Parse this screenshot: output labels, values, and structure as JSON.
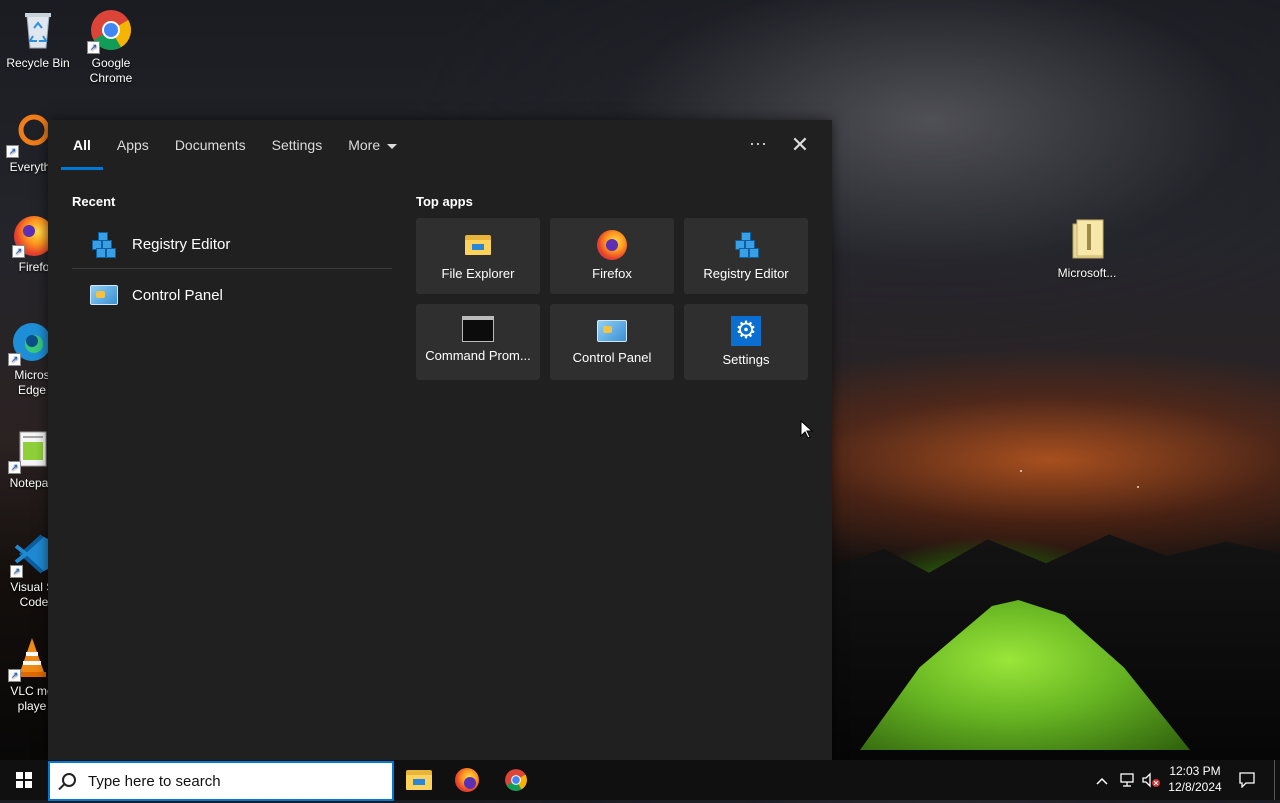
{
  "desktop": {
    "icons": [
      {
        "label": "Recycle Bin"
      },
      {
        "label": "Google Chrome"
      },
      {
        "label": "Everyth"
      },
      {
        "label": "Firefo"
      },
      {
        "label": "Micros Edge"
      },
      {
        "label": "Notepac"
      },
      {
        "label": "Visual St Code"
      },
      {
        "label": "VLC me playe"
      },
      {
        "label": "Microsoft..."
      }
    ]
  },
  "search_panel": {
    "tabs": [
      {
        "label": "All",
        "active": true
      },
      {
        "label": "Apps"
      },
      {
        "label": "Documents"
      },
      {
        "label": "Settings"
      },
      {
        "label": "More"
      }
    ],
    "options_label": "···",
    "close_label": "✕",
    "recent": {
      "title": "Recent",
      "items": [
        {
          "label": "Registry Editor",
          "icon": "registry-editor-icon"
        },
        {
          "label": "Control Panel",
          "icon": "control-panel-icon"
        }
      ]
    },
    "top_apps": {
      "title": "Top apps",
      "items": [
        {
          "label": "File Explorer",
          "icon": "file-explorer-icon"
        },
        {
          "label": "Firefox",
          "icon": "firefox-icon"
        },
        {
          "label": "Registry Editor",
          "icon": "registry-editor-icon"
        },
        {
          "label": "Command Prom...",
          "icon": "command-prompt-icon"
        },
        {
          "label": "Control Panel",
          "icon": "control-panel-icon"
        },
        {
          "label": "Settings",
          "icon": "settings-gear-icon"
        }
      ]
    }
  },
  "taskbar": {
    "search_placeholder": "Type here to search",
    "pinned": [
      "file-explorer-icon",
      "firefox-icon",
      "chrome-icon"
    ],
    "clock": {
      "time": "12:03 PM",
      "date": "12/8/2024"
    }
  },
  "colors": {
    "accent": "#0078d7",
    "panel_bg": "#202020",
    "tile_bg": "#2f2f2f",
    "taskbar_bg": "#101010"
  }
}
